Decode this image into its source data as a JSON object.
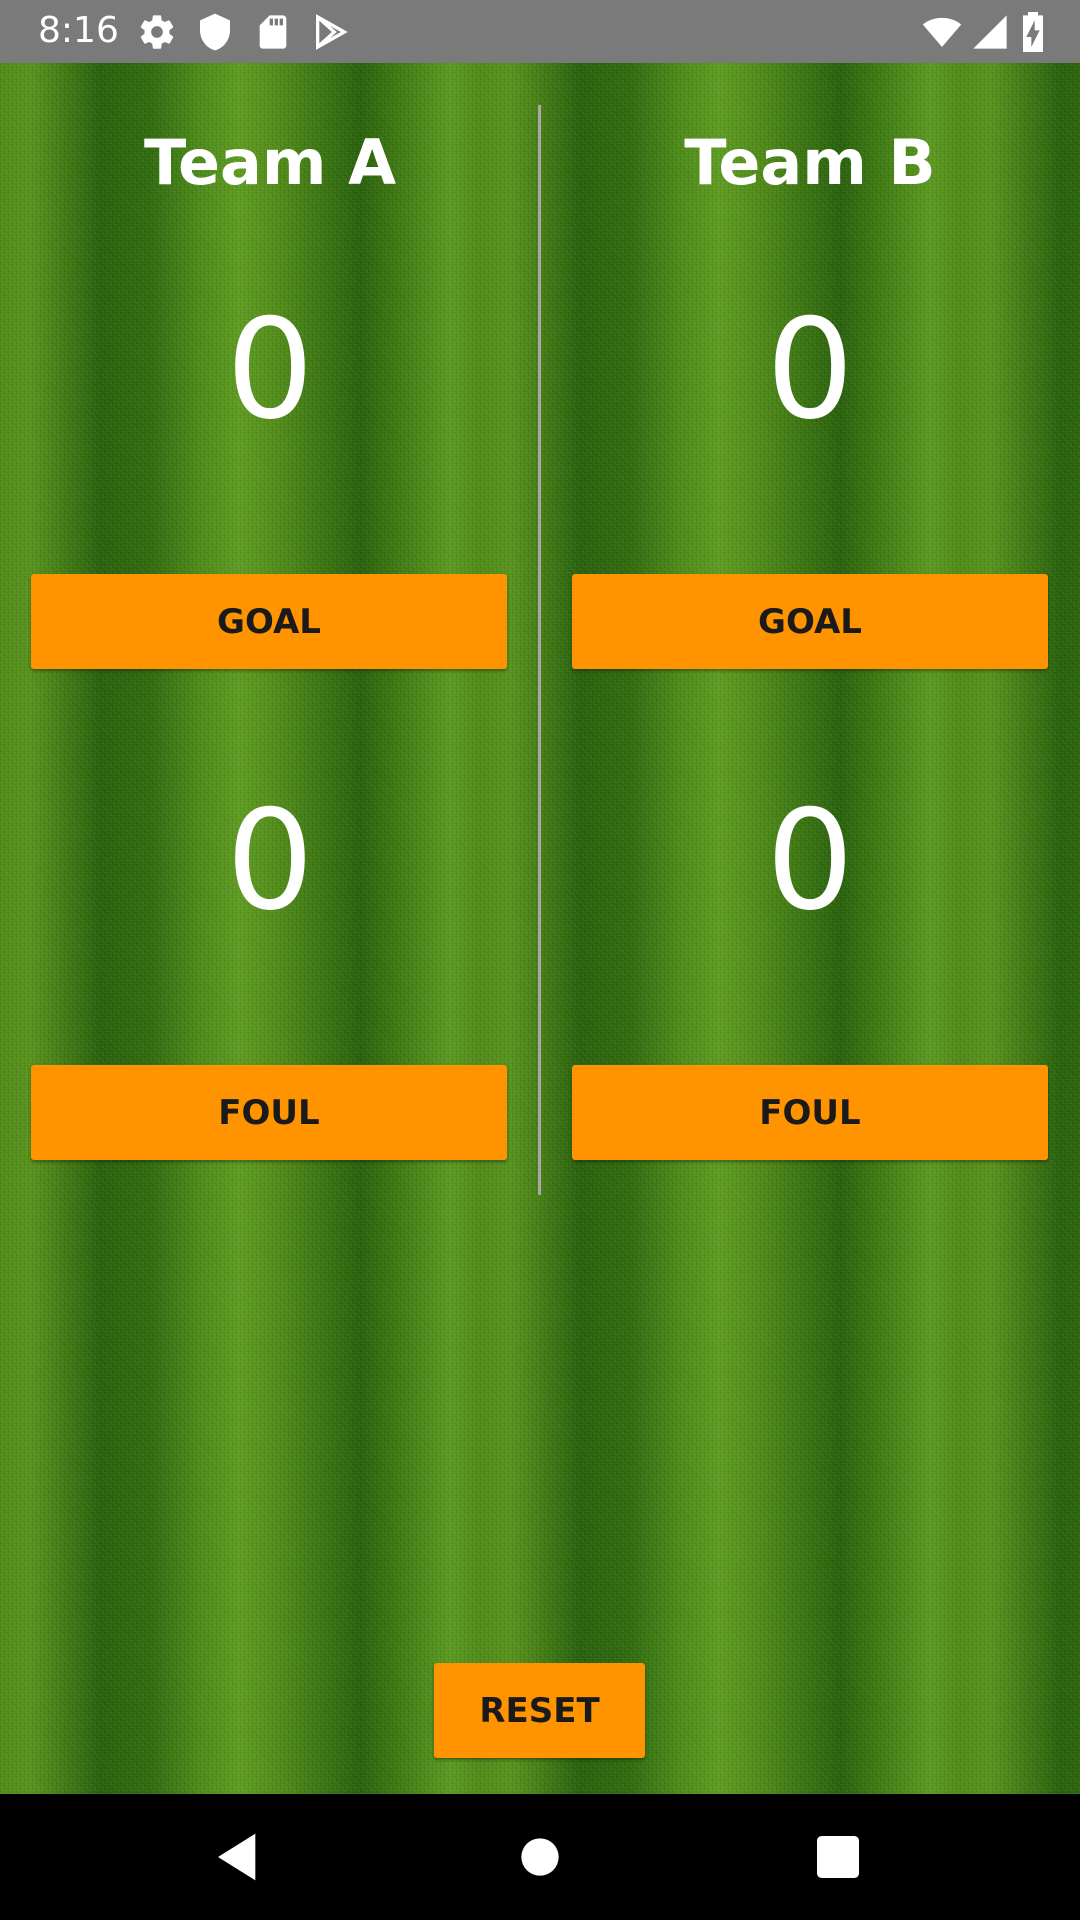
{
  "status_bar": {
    "time": "8:16",
    "icons": [
      "gear-icon",
      "shield-icon",
      "sd-card-icon",
      "play-store-icon",
      "wifi-icon",
      "signal-icon",
      "battery-charging-icon"
    ]
  },
  "team_a": {
    "name": "Team A",
    "goals": "0",
    "fouls": "0",
    "goal_button": "GOAL",
    "foul_button": "FOUL"
  },
  "team_b": {
    "name": "Team B",
    "goals": "0",
    "fouls": "0",
    "goal_button": "GOAL",
    "foul_button": "FOUL"
  },
  "reset_button": "RESET",
  "navigation": {
    "buttons": [
      "back-icon",
      "home-icon",
      "recents-icon"
    ]
  },
  "colors": {
    "button": "#ff9400",
    "status_bar": "#7a7a7a",
    "text": "#ffffff"
  }
}
